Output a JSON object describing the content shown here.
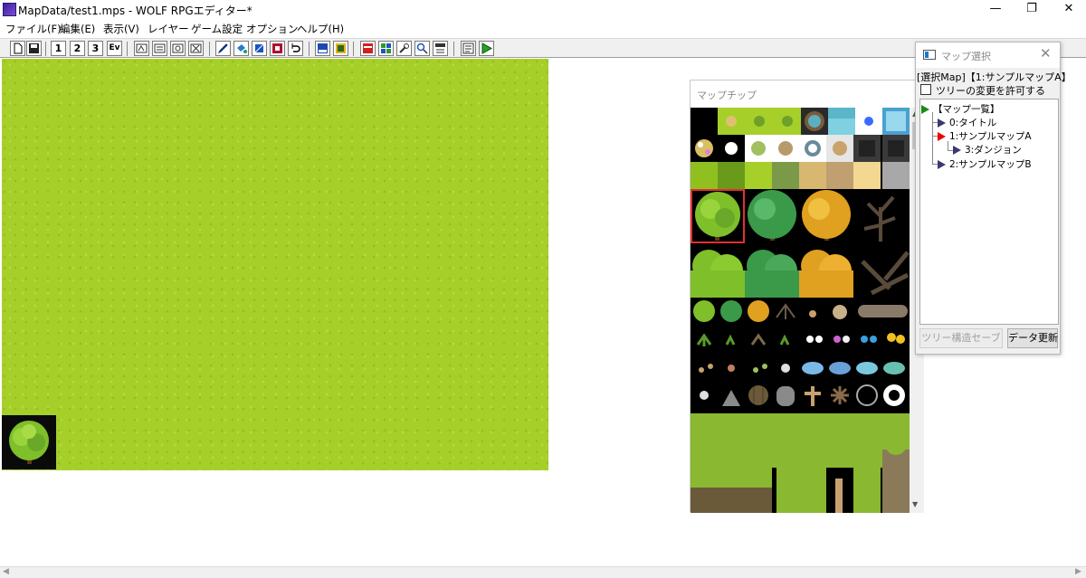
{
  "window": {
    "title": "MapData/test1.mps - WOLF RPGエディター*",
    "minimize": "—",
    "restore": "❐",
    "close": "✕"
  },
  "menu": [
    {
      "label": "ファイル(F)"
    },
    {
      "label": "編集(E)"
    },
    {
      "label": "表示(V)"
    },
    {
      "label": "レイヤー"
    },
    {
      "label": "ゲーム設定"
    },
    {
      "label": "オプション"
    },
    {
      "label": "ヘルプ(H)"
    }
  ],
  "toolbar": {
    "layer1": "1",
    "layer2": "2",
    "layer3": "3",
    "event": "Ev"
  },
  "chip_window": {
    "title": "マップチップ"
  },
  "map_select": {
    "title": "マップ選択",
    "selected_label": "[選択Map]【1:サンプルマップA】",
    "allow_tree_change": "ツリーの変更を許可する",
    "allow_tree_change_checked": false,
    "tree": [
      {
        "label": "【マップ一覧】",
        "icon": "green-triangle-icon",
        "level": 0
      },
      {
        "label": "0:タイトル",
        "icon": "triangle-icon",
        "level": 1
      },
      {
        "label": "1:サンプルマップA",
        "icon": "red-triangle-icon",
        "level": 1
      },
      {
        "label": "3:ダンジョン",
        "icon": "triangle-icon",
        "level": 2
      },
      {
        "label": "2:サンプルマップB",
        "icon": "triangle-icon",
        "level": 1
      }
    ],
    "save_tree_button": "ツリー構造セーブ",
    "refresh_button": "データ更新"
  },
  "colors": {
    "grass": "#a6cf2a",
    "selection": "#e03030"
  }
}
